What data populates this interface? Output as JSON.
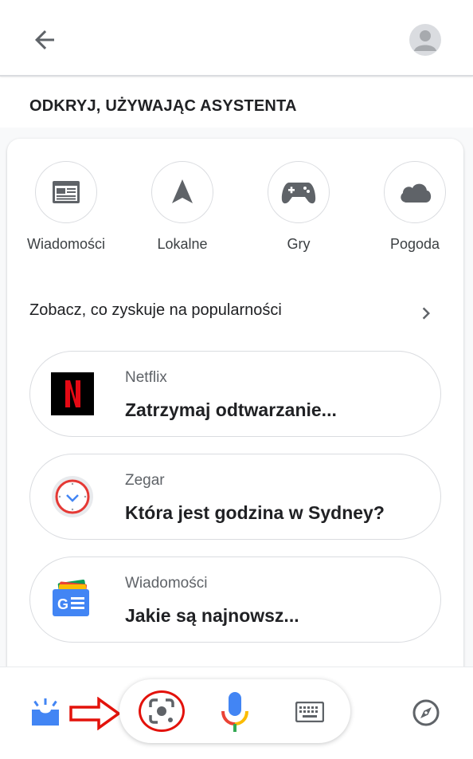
{
  "header": {
    "back_icon": "arrow-back-icon",
    "avatar_icon": "account-avatar-icon"
  },
  "section_title": "ODKRYJ, UŻYWAJĄC ASYSTENTA",
  "categories": [
    {
      "label": "Wiadomości",
      "icon": "newspaper-icon"
    },
    {
      "label": "Lokalne",
      "icon": "navigation-arrow-icon"
    },
    {
      "label": "Gry",
      "icon": "gamepad-icon"
    },
    {
      "label": "Pogoda",
      "icon": "cloud-icon"
    }
  ],
  "trending": {
    "label": "Zobacz, co zyskuje na popularności",
    "icon": "chevron-right-icon"
  },
  "suggestions": [
    {
      "app": "Netflix",
      "query": "Zatrzymaj odtwarzanie...",
      "icon": "netflix-logo-icon"
    },
    {
      "app": "Zegar",
      "query": "Która jest godzina w Sydney?",
      "icon": "clock-app-icon"
    },
    {
      "app": "Wiadomości",
      "query": "Jakie są najnowsz...",
      "icon": "google-news-icon"
    }
  ],
  "bottom_bar": {
    "snapshot_icon": "snapshot-tray-icon",
    "arrow_icon": "red-arrow-annotation-icon",
    "lens_icon": "google-lens-icon",
    "mic_icon": "microphone-icon",
    "keyboard_icon": "keyboard-icon",
    "explore_icon": "compass-icon"
  },
  "colors": {
    "google_blue": "#4285f4",
    "google_red": "#ea4335",
    "google_yellow": "#fbbc04",
    "google_green": "#34a853",
    "icon_grey": "#5f6368",
    "annotation_red": "#e3120b"
  }
}
